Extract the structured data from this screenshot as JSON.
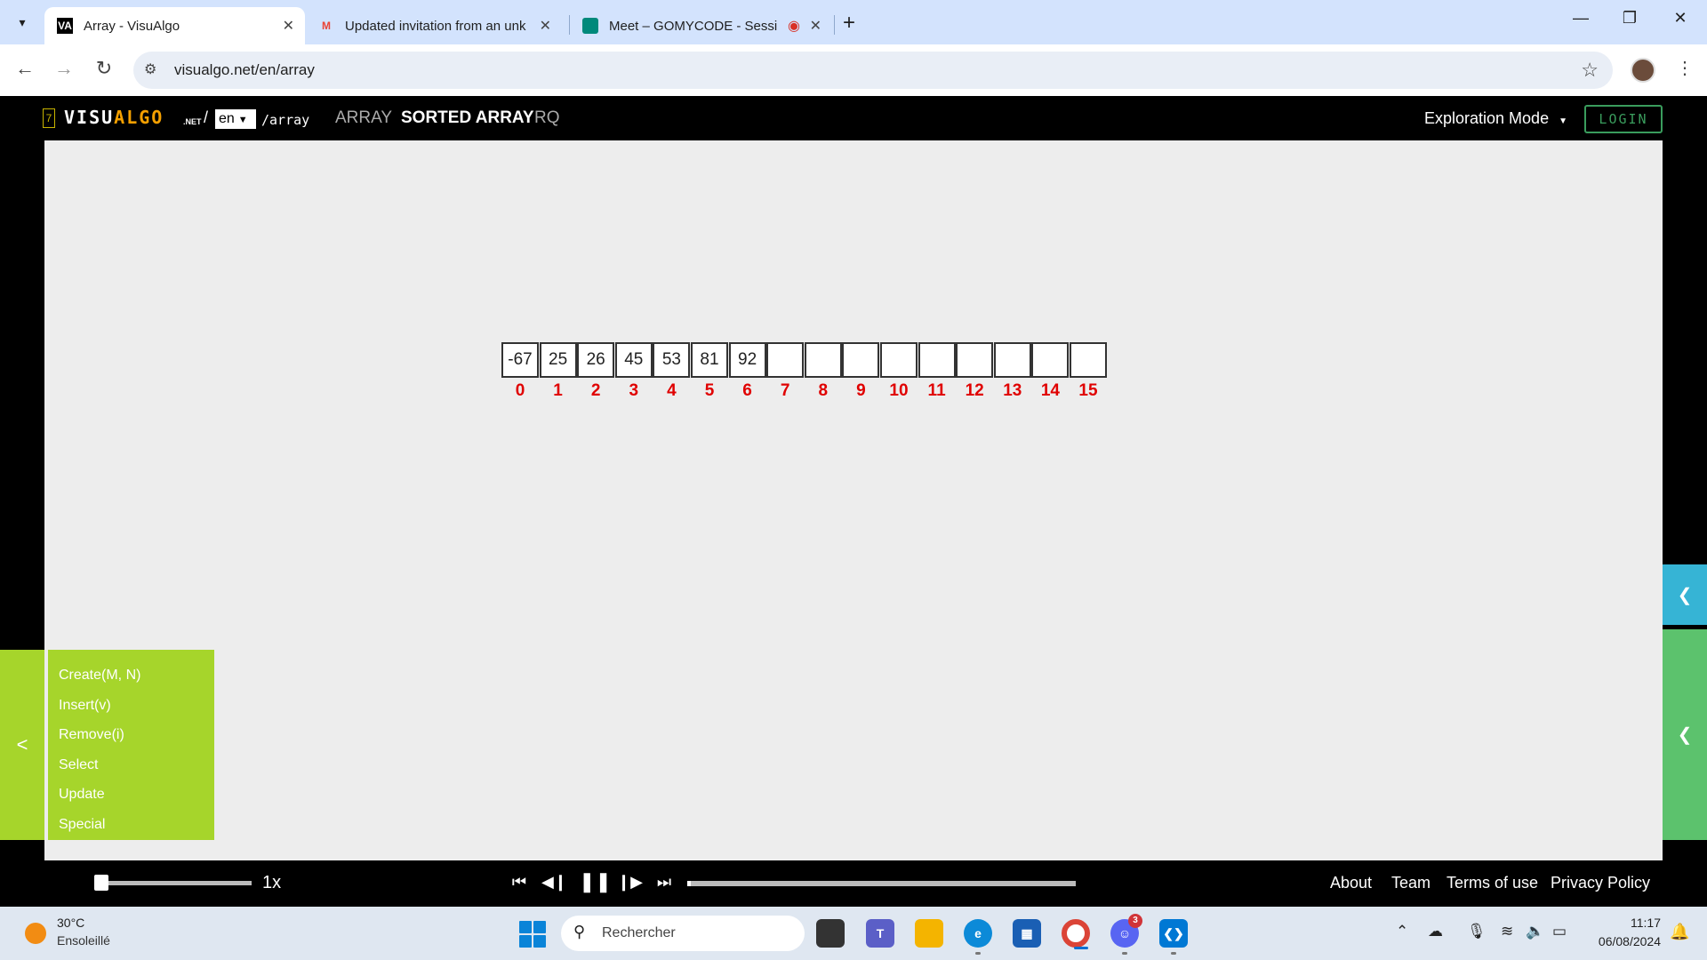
{
  "browser": {
    "tabs": [
      {
        "title": "Array - VisuAlgo",
        "favicon": "VA",
        "active": true
      },
      {
        "title": "Updated invitation from an unk",
        "favicon": "M",
        "active": false
      },
      {
        "title": "Meet – GOMYCODE - Sessi",
        "favicon": "meet",
        "active": false
      }
    ],
    "url": "visualgo.net/en/array"
  },
  "app": {
    "logo_digit": "7",
    "logo_visu": "VISU",
    "logo_algo": "ALGO",
    "logo_net": ".NET",
    "logo_slash": "/",
    "language": "en",
    "path": "/array",
    "menu": [
      {
        "label": "ARRAY",
        "active": false
      },
      {
        "label": "SORTED ARRAY",
        "active": true
      },
      {
        "label": "RQ",
        "active": false
      }
    ],
    "mode_label": "Exploration Mode",
    "login_label": "LOGIN"
  },
  "array": {
    "values": [
      "-67",
      "25",
      "26",
      "45",
      "53",
      "81",
      "92",
      "",
      "",
      "",
      "",
      "",
      "",
      "",
      "",
      ""
    ],
    "indices": [
      "0",
      "1",
      "2",
      "3",
      "4",
      "5",
      "6",
      "7",
      "8",
      "9",
      "10",
      "11",
      "12",
      "13",
      "14",
      "15"
    ]
  },
  "left_menu": {
    "toggle": "<",
    "items": [
      "Create(M, N)",
      "Insert(v)",
      "Remove(i)",
      "Select",
      "Update",
      "Special"
    ]
  },
  "playback": {
    "speed": "1x",
    "speed_fraction": 0.0,
    "progress_fraction": 0.01
  },
  "footer_links": [
    "About",
    "Team",
    "Terms of use",
    "Privacy Policy"
  ],
  "taskbar": {
    "temperature": "30°C",
    "weather": "Ensoleillé",
    "search_placeholder": "Rechercher",
    "discord_badge": "3",
    "time": "11:17",
    "date": "06/08/2024"
  },
  "colors": {
    "index_red": "#e00000",
    "panel_green": "#a6d52b",
    "right_blue": "#36b4d5",
    "right_green": "#5cc26d",
    "login_green": "#3a9d5d"
  }
}
